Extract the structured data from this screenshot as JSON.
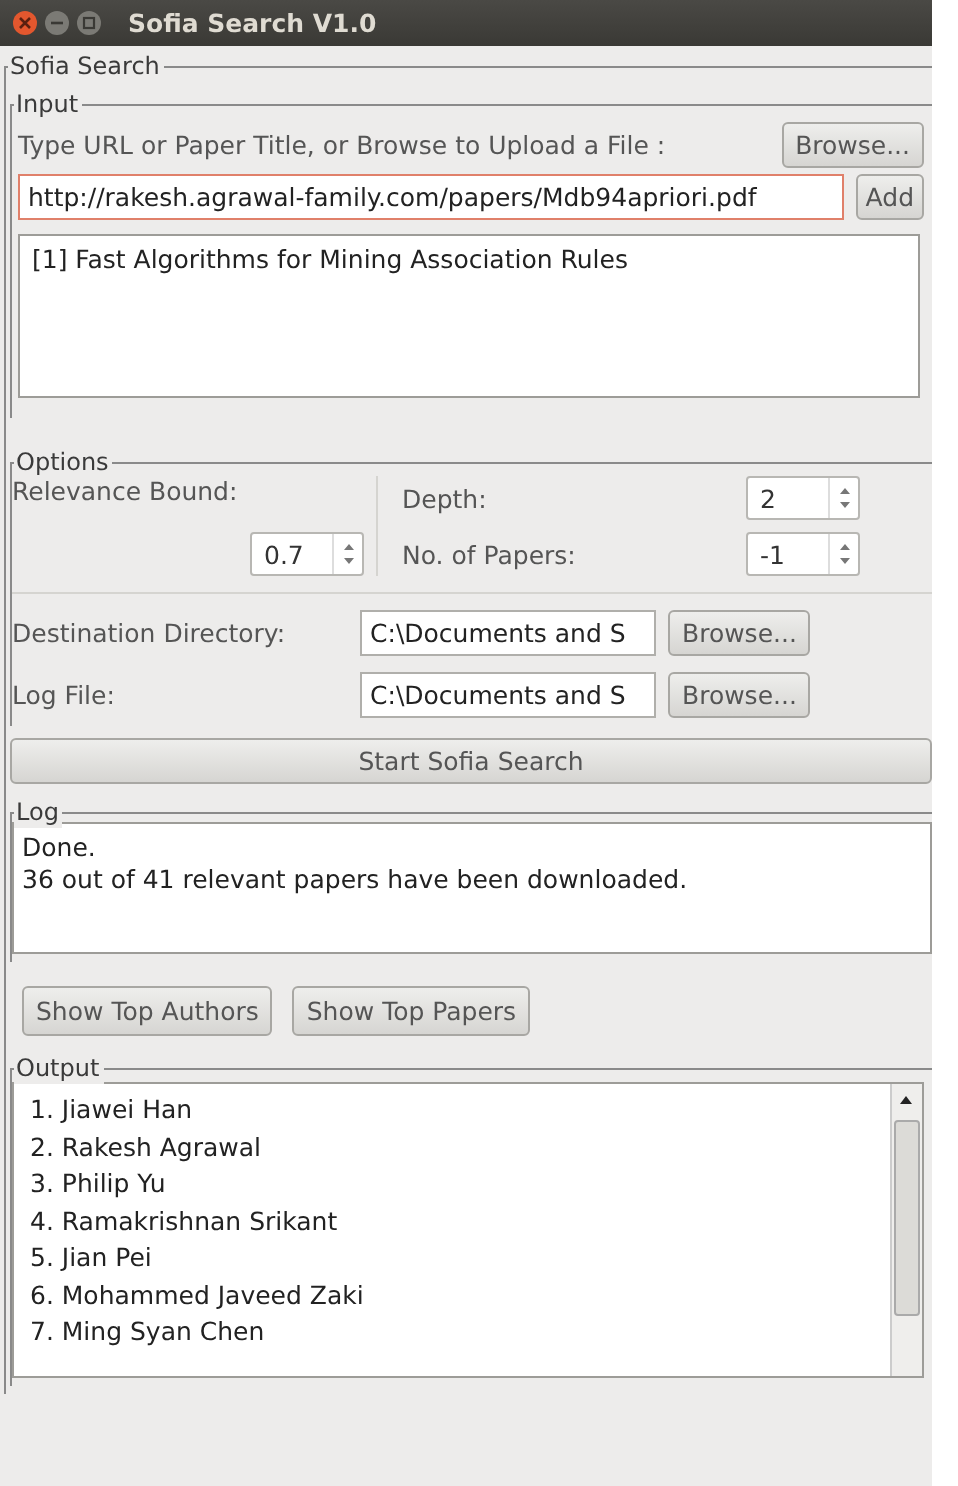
{
  "window": {
    "title": "Sofia Search V1.0"
  },
  "main_group": {
    "title": "Sofia Search"
  },
  "input": {
    "title": "Input",
    "prompt": "Type URL or Paper Title, or Browse to Upload a File :",
    "browse_button": "Browse...",
    "url": {
      "value": "http://rakesh.agrawal-family.com/papers/Mdb94apriori.pdf",
      "focused": true
    },
    "add_button": "Add",
    "papers": [
      "[1] Fast Algorithms for Mining Association Rules"
    ]
  },
  "options": {
    "title": "Options",
    "relevance_bound": {
      "label": "Relevance Bound:",
      "value": "0.7"
    },
    "depth": {
      "label": "Depth:",
      "value": "2"
    },
    "paper_count": {
      "label": "No. of Papers:",
      "value": "-1"
    },
    "destination": {
      "label": "Destination Directory:",
      "value": "C:\\Documents and S",
      "button": "Browse..."
    },
    "log_file": {
      "label": "Log File:",
      "value": "C:\\Documents and S",
      "button": "Browse..."
    }
  },
  "start_button": "Start Sofia Search",
  "log": {
    "title": "Log",
    "lines": [
      "Done.",
      "36 out of 41 relevant papers have been downloaded."
    ]
  },
  "actions": [
    "Show Top Authors",
    "Show Top Papers"
  ],
  "output": {
    "title": "Output",
    "lines": [
      "1. Jiawei Han",
      "2. Rakesh Agrawal",
      "3. Philip Yu",
      "4. Ramakrishnan Srikant",
      "5. Jian Pei",
      "6. Mohammed Javeed Zaki",
      "7. Ming Syan Chen"
    ]
  }
}
